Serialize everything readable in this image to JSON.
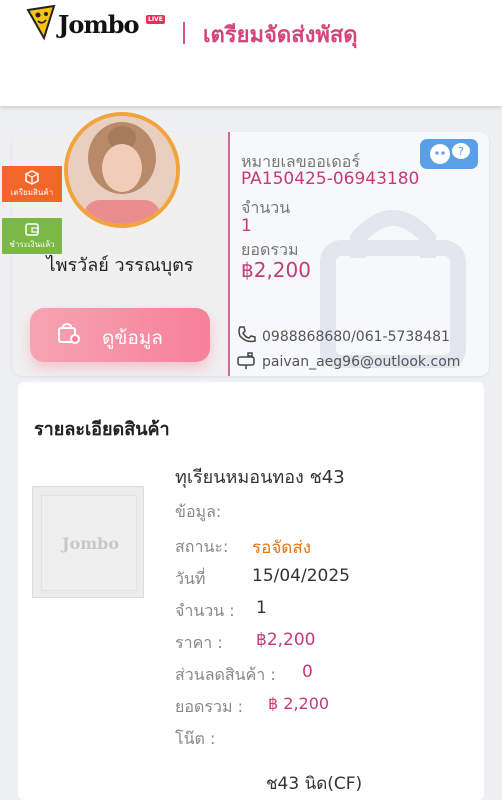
{
  "header": {
    "logo_text": "Jombo",
    "logo_badge": "LIVE",
    "title": "เตรียมจัดส่งพัสดุ"
  },
  "order": {
    "tags": {
      "prepare": "เตรียมสินค้า",
      "paid": "ชำระเงินแล้ว"
    },
    "customer_name": "ไพรวัลย์ วรรณบุตร",
    "view_button": "ดูข้อมูล",
    "order_no_label": "หมายเลขออเดอร์",
    "order_no": "PA150425-06943180",
    "qty_label": "จำนวน",
    "qty": "1",
    "total_label": "ยอดรวม",
    "total": "฿2,200",
    "phone": "0988868680/061-5738481",
    "email": "paivan_aeg96@outlook.com",
    "icons": {
      "tag_prepare": "box-icon",
      "tag_paid": "wallet-icon",
      "button": "cart-icon",
      "chat": "chat-support-icon",
      "phone": "phone-icon",
      "email": "mailbox-icon"
    },
    "colors": {
      "accent": "#c43b79",
      "tag_prepare": "#f2662a",
      "tag_paid": "#7bb845",
      "chat": "#5ba0e6"
    }
  },
  "details": {
    "title": "รายละเอียดสินค้า",
    "placeholder_text": "Jombo",
    "product_name": "ทุเรียนหมอนทอง ช43",
    "info_label": "ข้อมูล:",
    "status_label": "สถานะ:",
    "status_value": "รอจัดส่ง",
    "date_label": "วันที่",
    "date_value": "15/04/2025",
    "qty_label": "จำนวน :",
    "qty_value": "1",
    "price_label": "ราคา :",
    "price_value": "฿2,200",
    "discount_label": "ส่วนลดสินค้า :",
    "discount_value": "0",
    "total_label": "ยอดรวม :",
    "total_value": "฿ 2,200",
    "note_label": "โน๊ต :",
    "note_value": "ช43 นิด(CF)",
    "colors": {
      "status": "#e2761c",
      "amount": "#c43b79"
    }
  }
}
